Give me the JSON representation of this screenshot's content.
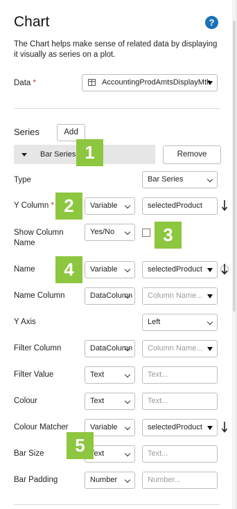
{
  "panel": {
    "title": "Chart",
    "help_icon": "question-icon",
    "help_glyph": "?",
    "description": "The Chart helps make sense of related data by displaying it visually as series on a plot."
  },
  "data_field": {
    "label": "Data",
    "required_mark": "*",
    "value": "AccountingProdAmtsDisplayMth"
  },
  "series": {
    "heading": "Series",
    "add_label": "Add",
    "item_label": "Bar Series",
    "remove_label": "Remove"
  },
  "fields": {
    "type": {
      "label": "Type",
      "value": "Bar Series"
    },
    "y_column": {
      "label": "Y Column",
      "required_mark": "*",
      "source": "Variable",
      "value": "selectedProduct"
    },
    "show_column_name": {
      "label": "Show Column Name",
      "source": "Yes/No",
      "checked": false
    },
    "name": {
      "label": "Name",
      "source": "Variable",
      "value": "selectedProduct"
    },
    "name_column": {
      "label": "Name Column",
      "source": "DataColumn",
      "placeholder": "Column Name..."
    },
    "y_axis": {
      "label": "Y Axis",
      "value": "Left"
    },
    "filter_column": {
      "label": "Filter Column",
      "source": "DataColumn",
      "placeholder": "Column Name..."
    },
    "filter_value": {
      "label": "Filter Value",
      "source": "Text",
      "placeholder": "Text..."
    },
    "colour": {
      "label": "Colour",
      "source": "Text",
      "placeholder": "Text..."
    },
    "colour_matcher": {
      "label": "Colour Matcher",
      "source": "Variable",
      "value": "selectedProduct"
    },
    "bar_size": {
      "label": "Bar Size",
      "source": "Text",
      "placeholder": "Text..."
    },
    "bar_padding": {
      "label": "Bar Padding",
      "source": "Number",
      "placeholder": "Number..."
    }
  },
  "badges": [
    "1",
    "2",
    "3",
    "4",
    "5"
  ],
  "colors": {
    "badge": "#8dc63f",
    "help": "#1a72b8",
    "required": "#c0392b"
  }
}
